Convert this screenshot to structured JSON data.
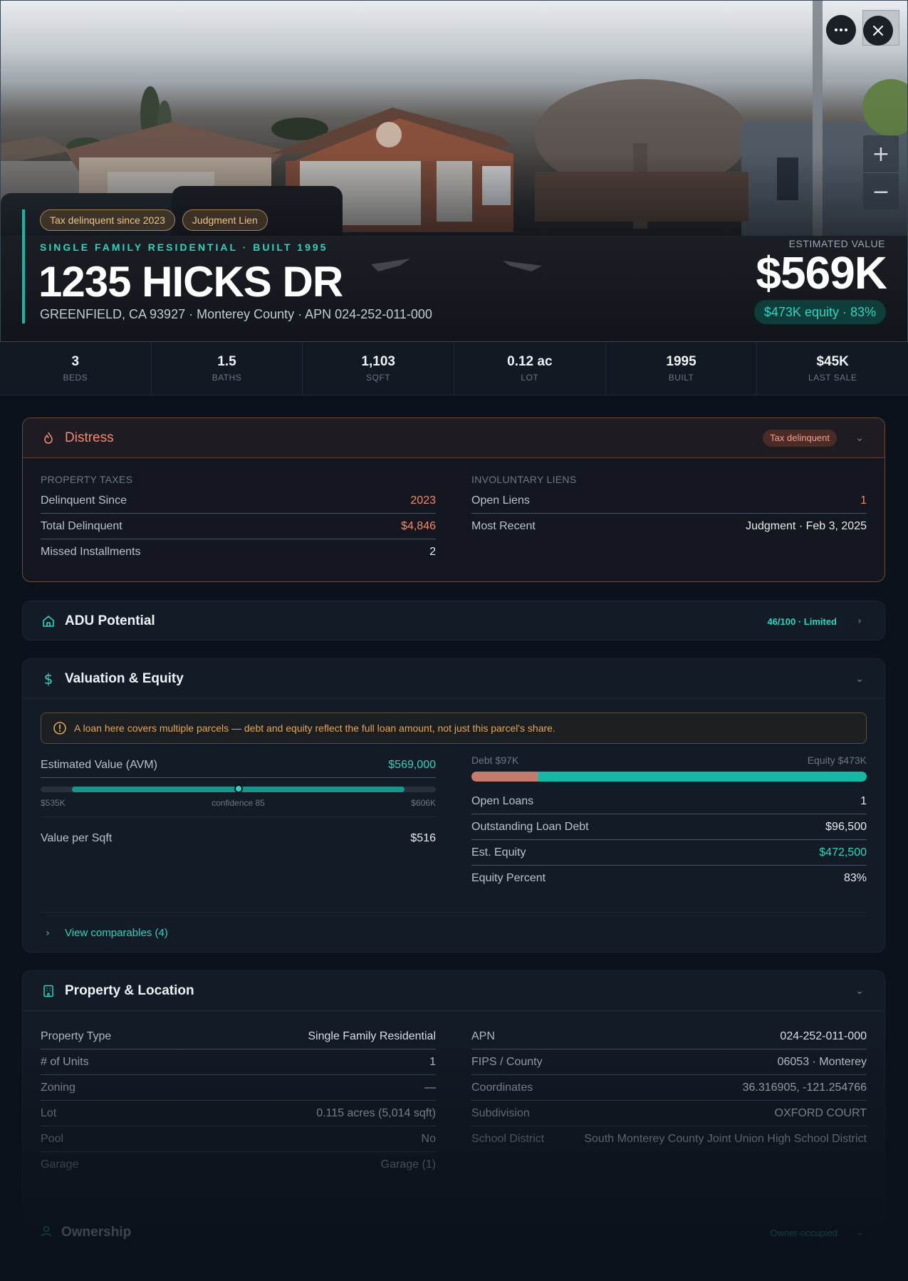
{
  "hero": {
    "badges": [
      "Tax delinquent since 2023",
      "Judgment Lien"
    ],
    "subtitle": "SINGLE FAMILY RESIDENTIAL · BUILT 1995",
    "title": "1235 HICKS DR",
    "address": "GREENFIELD, CA 93927 · Monterey County · APN 024-252-011-000",
    "est_label": "ESTIMATED VALUE",
    "est_value": "$569K",
    "equity_pill": "$473K equity · 83%",
    "more_icon": "more-horizontal-icon",
    "close_icon": "close-icon"
  },
  "stats": [
    {
      "value": "3",
      "label": "BEDS"
    },
    {
      "value": "1.5",
      "label": "BATHS"
    },
    {
      "value": "1,103",
      "label": "SQFT"
    },
    {
      "value": "0.12 ac",
      "label": "LOT"
    },
    {
      "value": "1995",
      "label": "BUILT"
    },
    {
      "value": "$45K",
      "label": "LAST SALE"
    }
  ],
  "distress": {
    "title": "Distress",
    "pill": "Tax delinquent",
    "left_section": "PROPERTY TAXES",
    "left_rows": [
      {
        "k": "Delinquent Since",
        "v": "2023"
      },
      {
        "k": "Total Delinquent",
        "v": "$4,846"
      },
      {
        "k": "Missed Installments",
        "v": "2"
      }
    ],
    "right_section": "INVOLUNTARY LIENS",
    "right_rows": [
      {
        "k": "Open Liens",
        "v": "1"
      },
      {
        "k": "Most Recent",
        "v": "Judgment · Feb 3, 2025"
      }
    ]
  },
  "adu": {
    "title": "ADU Potential",
    "score": "46/100 · Limited"
  },
  "valuation": {
    "title": "Valuation & Equity",
    "warning": "A loan here covers multiple parcels — debt and equity reflect the full loan amount, not just this parcel's share.",
    "avm_label": "Estimated Value (AVM)",
    "avm_value": "$569,000",
    "range_low": "$535K",
    "confidence": "confidence 85",
    "range_high": "$606K",
    "confidence_level": 0.5,
    "vps_label": "Value per Sqft",
    "vps_value": "$516",
    "debt_label": "Debt $97K",
    "equity_label": "Equity $473K",
    "debt_fraction": 0.17,
    "rows": [
      {
        "k": "Open Loans",
        "v": "1"
      },
      {
        "k": "Outstanding Loan Debt",
        "v": "$96,500"
      },
      {
        "k": "Est. Equity",
        "v": "$472,500"
      },
      {
        "k": "Equity Percent",
        "v": "83%"
      }
    ],
    "comps": "View comparables (4)"
  },
  "property": {
    "title": "Property & Location",
    "left_rows": [
      {
        "k": "Property Type",
        "v": "Single Family Residential"
      },
      {
        "k": "# of Units",
        "v": "1"
      },
      {
        "k": "Zoning",
        "v": "—"
      },
      {
        "k": "Lot",
        "v": "0.115 acres (5,014 sqft)"
      },
      {
        "k": "Pool",
        "v": "No"
      },
      {
        "k": "Garage",
        "v": "Garage (1)"
      }
    ],
    "right_rows": [
      {
        "k": "APN",
        "v": "024-252-011-000"
      },
      {
        "k": "FIPS / County",
        "v": "06053 · Monterey"
      },
      {
        "k": "Coordinates",
        "v": "36.316905, -121.254766"
      },
      {
        "k": "Subdivision",
        "v": "OXFORD COURT"
      },
      {
        "k": "School District",
        "v": "South Monterey County Joint Union High School District"
      }
    ]
  },
  "ownership": {
    "title": "Ownership",
    "pill": "Owner-occupied"
  }
}
